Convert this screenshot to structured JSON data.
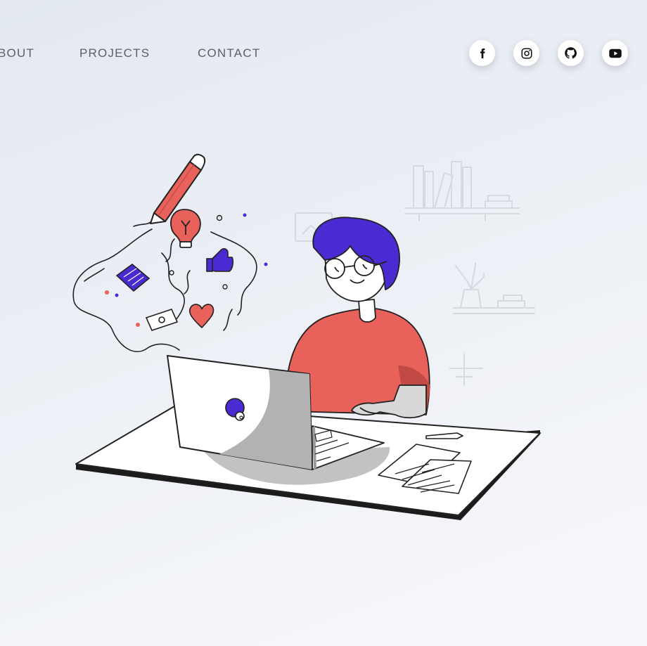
{
  "nav": {
    "items": [
      {
        "label": "BOUT"
      },
      {
        "label": "PROJECTS"
      },
      {
        "label": "CONTACT"
      }
    ]
  },
  "social": {
    "links": [
      {
        "icon": "facebook-icon"
      },
      {
        "icon": "instagram-icon"
      },
      {
        "icon": "github-icon"
      },
      {
        "icon": "youtube-icon"
      }
    ]
  },
  "colors": {
    "accent_purple": "#4a2bd1",
    "accent_red": "#e8615a",
    "text_nav": "#5c5f66",
    "background": "#eef1f6"
  }
}
